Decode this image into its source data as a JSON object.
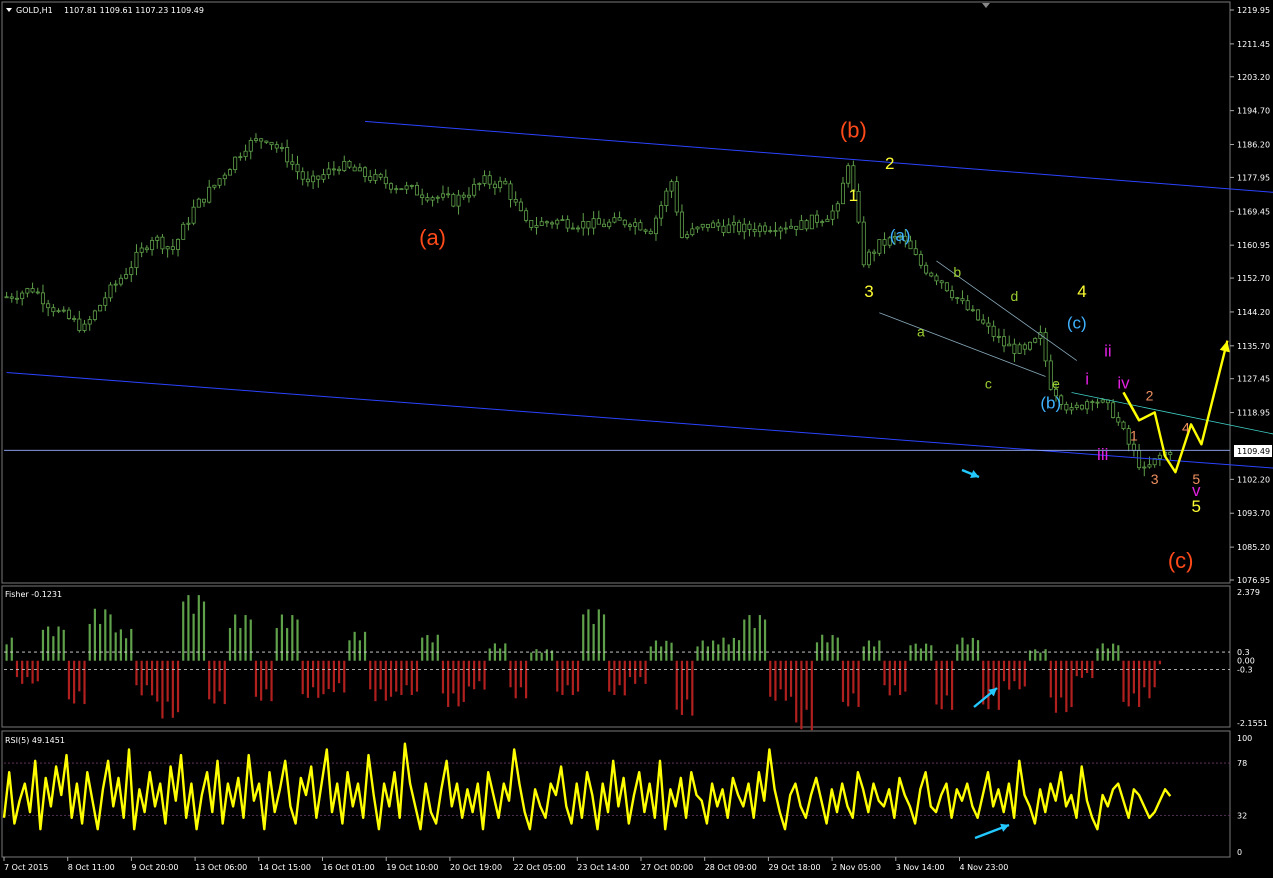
{
  "header": {
    "symbol_label": "GOLD,H1",
    "ohlc_label": "1107.81 1109.61 1107.23 1109.49",
    "fisher_label": "Fisher -0.1231",
    "rsi_label": "RSI(5) 49.1451",
    "current_price_label": "1109.49"
  },
  "colors": {
    "candles": "#5fa04a",
    "channel": "#2b43ff",
    "fisher_pos": "#5fa04a",
    "fisher_neg": "#b0201e",
    "rsi": "#ffff00",
    "level": "#9a7a9a",
    "projection": "#ffff00",
    "cyan_arrow": "#22c8ff",
    "wave_red": "#ff4a1a",
    "wave_yellow": "#ffff33",
    "wave_blue": "#3fb2ff",
    "wave_green": "#9acd32",
    "wave_magenta": "#e020e0",
    "wave_salmon": "#f09060"
  },
  "chart_data": [
    {
      "type": "candlestick",
      "title": "GOLD,H1",
      "ylim": [
        1076.95,
        1219.95
      ],
      "y_ticks": [
        "1219.95",
        "1211.45",
        "1203.20",
        "1194.70",
        "1186.20",
        "1177.95",
        "1169.45",
        "1160.95",
        "1152.70",
        "1144.20",
        "1135.70",
        "1127.45",
        "1118.95",
        "1102.20",
        "1093.70",
        "1085.20",
        "1076.95"
      ],
      "x_ticks": [
        "7 Oct 2015",
        "8 Oct 11:00",
        "9 Oct 20:00",
        "13 Oct 06:00",
        "14 Oct 15:00",
        "16 Oct 01:00",
        "19 Oct 10:00",
        "20 Oct 19:00",
        "22 Oct 05:00",
        "23 Oct 14:00",
        "27 Oct 00:00",
        "28 Oct 09:00",
        "29 Oct 18:00",
        "2 Nov 05:00",
        "3 Nov 14:00",
        "4 Nov 23:00"
      ],
      "close_path": [
        [
          0,
          1148
        ],
        [
          5,
          1150
        ],
        [
          10,
          1144
        ],
        [
          15,
          1140
        ],
        [
          19,
          1148
        ],
        [
          24,
          1156
        ],
        [
          28,
          1163
        ],
        [
          32,
          1160
        ],
        [
          36,
          1170
        ],
        [
          40,
          1176
        ],
        [
          46,
          1186
        ],
        [
          50,
          1188
        ],
        [
          54,
          1183
        ],
        [
          58,
          1176
        ],
        [
          64,
          1181
        ],
        [
          72,
          1177
        ],
        [
          80,
          1174
        ],
        [
          86,
          1172
        ],
        [
          92,
          1177
        ],
        [
          96,
          1176
        ],
        [
          100,
          1166
        ],
        [
          106,
          1167
        ],
        [
          114,
          1166
        ],
        [
          120,
          1167
        ],
        [
          124,
          1165
        ],
        [
          128,
          1177
        ],
        [
          130,
          1163
        ],
        [
          135,
          1166
        ],
        [
          142,
          1165
        ],
        [
          148,
          1166
        ],
        [
          153,
          1166
        ],
        [
          157,
          1168
        ],
        [
          160,
          1170
        ],
        [
          162,
          1182
        ],
        [
          165,
          1157
        ],
        [
          168,
          1161
        ],
        [
          172,
          1163
        ],
        [
          176,
          1156
        ],
        [
          180,
          1152
        ],
        [
          184,
          1146
        ],
        [
          188,
          1141
        ],
        [
          192,
          1136
        ],
        [
          196,
          1134
        ],
        [
          199,
          1138
        ],
        [
          201,
          1126
        ],
        [
          205,
          1119
        ],
        [
          209,
          1123
        ],
        [
          213,
          1119
        ],
        [
          216,
          1111
        ],
        [
          219,
          1104
        ],
        [
          222,
          1108
        ],
        [
          224,
          1109.49
        ]
      ],
      "current_price": 1109.49,
      "channel_upper": [
        [
          69,
          1192
        ],
        [
          295,
          1169
        ]
      ],
      "channel_lower": [
        [
          0,
          1129
        ],
        [
          295,
          1100
        ]
      ],
      "inner_channel_upper": [
        [
          179,
          1157
        ],
        [
          206,
          1132
        ]
      ],
      "inner_channel_lower": [
        [
          168,
          1144
        ],
        [
          200,
          1128
        ]
      ],
      "wave_trendline": [
        [
          205,
          1124
        ],
        [
          246,
          1113
        ]
      ],
      "projection": [
        [
          215,
          1124
        ],
        [
          218,
          1117
        ],
        [
          221,
          1119
        ],
        [
          223,
          1108
        ],
        [
          225,
          1104
        ],
        [
          228,
          1116
        ],
        [
          230,
          1111
        ],
        [
          235,
          1137
        ]
      ],
      "annotations": [
        {
          "text": "(a)",
          "x": 82,
          "y": 1161,
          "color": "wave_red"
        },
        {
          "text": "(b)",
          "x": 163,
          "y": 1188,
          "color": "wave_red"
        },
        {
          "text": "(c)",
          "x": 226,
          "y": 1080,
          "color": "wave_red"
        },
        {
          "text": "2",
          "x": 170,
          "y": 1180,
          "color": "wave_yellow"
        },
        {
          "text": "1",
          "x": 163,
          "y": 1172,
          "color": "wave_yellow"
        },
        {
          "text": "3",
          "x": 166,
          "y": 1148,
          "color": "wave_yellow"
        },
        {
          "text": "4",
          "x": 207,
          "y": 1148,
          "color": "wave_yellow"
        },
        {
          "text": "5",
          "x": 229,
          "y": 1094,
          "color": "wave_yellow"
        },
        {
          "text": "(a)",
          "x": 172,
          "y": 1162,
          "color": "wave_blue"
        },
        {
          "text": "(b)",
          "x": 201,
          "y": 1120,
          "color": "wave_blue"
        },
        {
          "text": "(c)",
          "x": 206,
          "y": 1140,
          "color": "wave_blue"
        },
        {
          "text": "a",
          "x": 176,
          "y": 1138,
          "color": "wave_green"
        },
        {
          "text": "b",
          "x": 183,
          "y": 1153,
          "color": "wave_green"
        },
        {
          "text": "c",
          "x": 189,
          "y": 1125,
          "color": "wave_green"
        },
        {
          "text": "d",
          "x": 194,
          "y": 1147,
          "color": "wave_green"
        },
        {
          "text": "e",
          "x": 202,
          "y": 1125,
          "color": "wave_green"
        },
        {
          "text": "i",
          "x": 208,
          "y": 1126,
          "color": "wave_magenta"
        },
        {
          "text": "ii",
          "x": 212,
          "y": 1133,
          "color": "wave_magenta"
        },
        {
          "text": "iii",
          "x": 211,
          "y": 1107,
          "color": "wave_magenta"
        },
        {
          "text": "iv",
          "x": 215,
          "y": 1125,
          "color": "wave_magenta"
        },
        {
          "text": "v",
          "x": 229,
          "y": 1098,
          "color": "wave_magenta"
        },
        {
          "text": "1",
          "x": 217,
          "y": 1112,
          "color": "wave_salmon"
        },
        {
          "text": "2",
          "x": 220,
          "y": 1122,
          "color": "wave_salmon"
        },
        {
          "text": "3",
          "x": 221,
          "y": 1101,
          "color": "wave_salmon"
        },
        {
          "text": "4",
          "x": 227,
          "y": 1114,
          "color": "wave_salmon"
        },
        {
          "text": "5",
          "x": 229,
          "y": 1101,
          "color": "wave_salmon"
        }
      ]
    },
    {
      "type": "bar",
      "title": "Fisher -0.1231",
      "ylim": [
        -2.1551,
        2.379
      ],
      "y_ticks": [
        "2.379",
        "0.3",
        "0.00",
        "-0.3",
        "-2.1551"
      ],
      "levels": [
        0.3,
        -0.3
      ],
      "last_value": -0.1231,
      "waves": [
        [
          0,
          0.8
        ],
        [
          4,
          -0.8
        ],
        [
          9,
          1.2
        ],
        [
          14,
          -1.5
        ],
        [
          18,
          1.8
        ],
        [
          23,
          1.1
        ],
        [
          27,
          -1.2
        ],
        [
          31,
          -2
        ],
        [
          36,
          2.3
        ],
        [
          41,
          -1.5
        ],
        [
          45,
          1.6
        ],
        [
          50,
          -1.4
        ],
        [
          54,
          1.6
        ],
        [
          59,
          -1.3
        ],
        [
          64,
          -1.1
        ],
        [
          68,
          1
        ],
        [
          72,
          -1.4
        ],
        [
          77,
          -1.2
        ],
        [
          82,
          0.9
        ],
        [
          86,
          -1.6
        ],
        [
          91,
          -1
        ],
        [
          95,
          0.6
        ],
        [
          99,
          -1.3
        ],
        [
          103,
          0.4
        ],
        [
          108,
          -1.2
        ],
        [
          113,
          1.8
        ],
        [
          118,
          -1.2
        ],
        [
          122,
          -0.8
        ],
        [
          126,
          0.7
        ],
        [
          131,
          -1.9
        ],
        [
          135,
          0.7
        ],
        [
          139,
          0.8
        ],
        [
          144,
          1.6
        ],
        [
          149,
          -1.4
        ],
        [
          154,
          -2.4
        ],
        [
          158,
          0.9
        ],
        [
          163,
          -1.6
        ],
        [
          167,
          0.7
        ],
        [
          171,
          -1.2
        ],
        [
          176,
          0.6
        ],
        [
          181,
          -1.7
        ],
        [
          185,
          0.8
        ],
        [
          190,
          -1.7
        ],
        [
          194,
          -1
        ],
        [
          199,
          0.4
        ],
        [
          203,
          -1.8
        ],
        [
          208,
          -0.6
        ],
        [
          212,
          0.6
        ],
        [
          217,
          -1.6
        ],
        [
          221,
          -1.3
        ]
      ]
    },
    {
      "type": "line",
      "title": "RSI(5) 49.1451",
      "ylim": [
        0,
        100
      ],
      "y_ticks": [
        "100",
        "78",
        "32",
        "0"
      ],
      "levels": [
        78,
        32
      ],
      "last_value": 49.1451,
      "series": [
        {
          "values": [
            30,
            70,
            25,
            45,
            60,
            35,
            80,
            20,
            65,
            40,
            75,
            50,
            85,
            30,
            60,
            25,
            70,
            45,
            20,
            55,
            80,
            40,
            65,
            30,
            90,
            20,
            55,
            35,
            70,
            40,
            60,
            25,
            75,
            45,
            85,
            30,
            60,
            20,
            50,
            70,
            35,
            80,
            25,
            60,
            40,
            65,
            30,
            85,
            45,
            60,
            20,
            70,
            35,
            55,
            80,
            40,
            25,
            65,
            50,
            75,
            30,
            60,
            90,
            35,
            60,
            25,
            70,
            40,
            60,
            30,
            85,
            50,
            20,
            60,
            40,
            70,
            30,
            95,
            60,
            40,
            20,
            60,
            35,
            25,
            55,
            80,
            40,
            60,
            30,
            55,
            35,
            60,
            20,
            70,
            50,
            30,
            60,
            45,
            90,
            60,
            35,
            20,
            55,
            40,
            30,
            60,
            50,
            75,
            40,
            25,
            60,
            30,
            70,
            50,
            20,
            60,
            35,
            80,
            40,
            65,
            25,
            50,
            70,
            35,
            60,
            30,
            80,
            20,
            55,
            40,
            65,
            30,
            70,
            50,
            45,
            25,
            60,
            40,
            55,
            30,
            65,
            50,
            40,
            60,
            30,
            70,
            45,
            90,
            55,
            35,
            20,
            50,
            60,
            40,
            30,
            50,
            65,
            45,
            25,
            55,
            35,
            60,
            40,
            30,
            70,
            55,
            35,
            60,
            45,
            40,
            55,
            30,
            65,
            50,
            40,
            25,
            55,
            70,
            40,
            35,
            50,
            60,
            30,
            55,
            45,
            60,
            40,
            30,
            50,
            70,
            40,
            55,
            35,
            60,
            30,
            80,
            50,
            40,
            25,
            55,
            35,
            60,
            45,
            70,
            40,
            50,
            30,
            75,
            45,
            30,
            20,
            50,
            40,
            55,
            60,
            45,
            30,
            55,
            50,
            40,
            30,
            35,
            45,
            55,
            49
          ]
        }
      ]
    },
    {
      "type": "annotations",
      "time_axis_labels": [
        "7 Oct 2015",
        "8 Oct 11:00",
        "9 Oct 20:00",
        "13 Oct 06:00",
        "14 Oct 15:00",
        "16 Oct 01:00",
        "19 Oct 10:00",
        "20 Oct 19:00",
        "22 Oct 05:00",
        "23 Oct 14:00",
        "27 Oct 00:00",
        "28 Oct 09:00",
        "29 Oct 18:00",
        "2 Nov 05:00",
        "3 Nov 14:00",
        "4 Nov 23:00"
      ]
    }
  ]
}
